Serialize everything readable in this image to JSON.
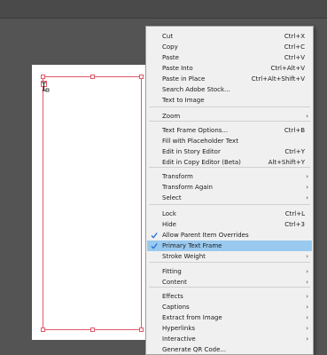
{
  "menu": {
    "items": [
      {
        "label": "Cut",
        "shortcut": "Ctrl+X"
      },
      {
        "label": "Copy",
        "shortcut": "Ctrl+C"
      },
      {
        "label": "Paste",
        "shortcut": "Ctrl+V"
      },
      {
        "label": "Paste Into",
        "shortcut": "Ctrl+Alt+V"
      },
      {
        "label": "Paste in Place",
        "shortcut": "Ctrl+Alt+Shift+V"
      },
      {
        "label": "Search Adobe Stock..."
      },
      {
        "label": "Text to Image"
      },
      {
        "label": "Zoom",
        "submenu": true
      },
      {
        "label": "Text Frame Options...",
        "shortcut": "Ctrl+B"
      },
      {
        "label": "Fill with Placeholder Text"
      },
      {
        "label": "Edit in Story Editor",
        "shortcut": "Ctrl+Y"
      },
      {
        "label": "Edit in Copy Editor (Beta)",
        "shortcut": "Alt+Shift+Y"
      },
      {
        "label": "Transform",
        "submenu": true
      },
      {
        "label": "Transform Again",
        "submenu": true
      },
      {
        "label": "Select",
        "submenu": true
      },
      {
        "label": "Lock",
        "shortcut": "Ctrl+L"
      },
      {
        "label": "Hide",
        "shortcut": "Ctrl+3"
      },
      {
        "label": "Allow Parent Item Overrides",
        "checked": true
      },
      {
        "label": "Primary Text Frame",
        "checked": true,
        "highlighted": true
      },
      {
        "label": "Stroke Weight",
        "submenu": true
      },
      {
        "label": "Fitting",
        "submenu": true
      },
      {
        "label": "Content",
        "submenu": true
      },
      {
        "label": "Effects",
        "submenu": true
      },
      {
        "label": "Captions",
        "submenu": true
      },
      {
        "label": "Extract from Image",
        "submenu": true
      },
      {
        "label": "Hyperlinks",
        "submenu": true
      },
      {
        "label": "Interactive",
        "submenu": true
      },
      {
        "label": "Generate QR Code..."
      }
    ]
  },
  "icons": {
    "submenu_arrow": "chevron-right-icon",
    "check": "check-icon",
    "text_cursor": "type-cursor-icon"
  },
  "colors": {
    "highlight": "#99c9ef",
    "check": "#1e6fd6",
    "frame": "#e05a6a",
    "canvas": "#545454"
  }
}
